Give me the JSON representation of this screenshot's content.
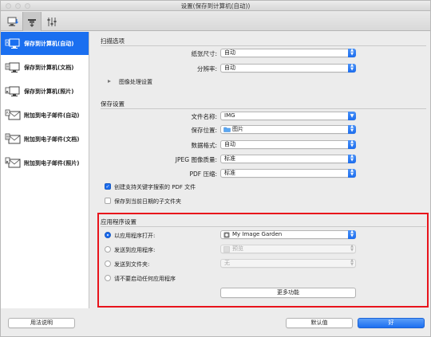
{
  "window": {
    "title": "设置(保存到计算机(自动))"
  },
  "toolbar": {
    "tabs": [
      {
        "icon": "scan-to-pc-icon"
      },
      {
        "icon": "scanner-icon"
      },
      {
        "icon": "tools-icon"
      }
    ]
  },
  "sidebar": {
    "items": [
      {
        "label": "保存到计算机(自动)",
        "icon": "auto-save-icon",
        "selected": true
      },
      {
        "label": "保存到计算机(文档)",
        "icon": "document-save-icon",
        "selected": false
      },
      {
        "label": "保存到计算机(照片)",
        "icon": "photo-save-icon",
        "selected": false
      },
      {
        "label": "附加到电子邮件(自动)",
        "icon": "auto-email-icon",
        "selected": false
      },
      {
        "label": "附加到电子邮件(文档)",
        "icon": "document-email-icon",
        "selected": false
      },
      {
        "label": "附加到电子邮件(照片)",
        "icon": "photo-email-icon",
        "selected": false
      }
    ]
  },
  "scan_options": {
    "title": "扫描选项",
    "paper_size_label": "纸张尺寸:",
    "paper_size_value": "自动",
    "resolution_label": "分辨率:",
    "resolution_value": "自动",
    "image_processing_label": "图像处理设置"
  },
  "save_settings": {
    "title": "保存设置",
    "file_name_label": "文件名称:",
    "file_name_value": "IMG",
    "save_in_label": "保存位置:",
    "save_in_value": "图片",
    "data_format_label": "数据格式:",
    "data_format_value": "自动",
    "jpeg_quality_label": "JPEG 图像质量:",
    "jpeg_quality_value": "标准",
    "pdf_compression_label": "PDF 压缩:",
    "pdf_compression_value": "标准",
    "create_pdf_keyword_label": "创建支持关键字搜索的 PDF 文件",
    "create_pdf_keyword_checked": true,
    "save_subfolder_label": "保存到当前日期的子文件夹",
    "save_subfolder_checked": false
  },
  "app_settings": {
    "title": "应用程序设置",
    "open_with_label": "以应用程序打开:",
    "open_with_value": "My Image Garden",
    "send_to_app_label": "发送到应用程序:",
    "send_to_app_value": "预览",
    "send_to_folder_label": "发送到文件夹:",
    "send_to_folder_value": "无",
    "do_not_start_label": "请不要启动任何应用程序",
    "more_functions_label": "更多功能",
    "selected_option": "open_with"
  },
  "footer": {
    "instructions_label": "用法说明",
    "defaults_label": "默认值",
    "ok_label": "好"
  },
  "colors": {
    "accent": "#1a6ff0",
    "highlight": "#e8131b"
  }
}
